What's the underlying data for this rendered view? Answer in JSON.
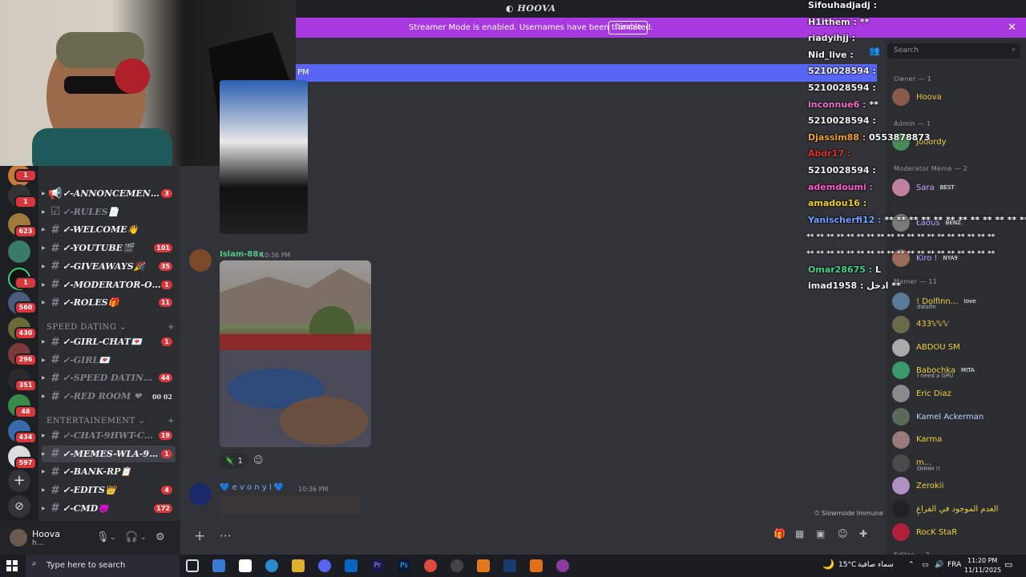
{
  "window": {
    "title": "HOOVA"
  },
  "notice": {
    "message": "Streamer Mode is enabled. Usernames have been truncated.",
    "action": "Disable"
  },
  "new_messages_bar": {
    "text": "PM"
  },
  "rail": {
    "badges": [
      "1",
      "1",
      "623",
      "1",
      "560",
      "430",
      "296",
      "351",
      "48",
      "434",
      "597"
    ]
  },
  "channels": [
    {
      "name": "✓-ANNONCEMENTS…",
      "badge": "3",
      "icon": "megaphone-icon"
    },
    {
      "name": "✓-RULES📄",
      "badge": "",
      "icon": "rules-icon",
      "dim": true
    },
    {
      "name": "✓-WELCOME👋",
      "badge": ""
    },
    {
      "name": "✓-YOUTUBE🎬",
      "badge": "101"
    },
    {
      "name": "✓-GIVEAWAYS🎉",
      "badge": "35"
    },
    {
      "name": "✓-MODERATOR-ON…",
      "badge": "1"
    },
    {
      "name": "✓-ROLES🎁",
      "badge": "11"
    }
  ],
  "category_speed": "SPEED DATING",
  "channels_speed": [
    {
      "name": "✓-GIRL-CHAT💌",
      "badge": "1"
    },
    {
      "name": "✓-GIRL💌",
      "badge": "",
      "dim": true
    },
    {
      "name": "✓-SPEED DATING💍",
      "badge": "44",
      "dim": true
    },
    {
      "name": "✓-RED ROOM ❤",
      "badge": "",
      "dim": true,
      "extra": "00  02"
    }
  ],
  "category_entertainment": "ENTERTAINEMENT",
  "channels_ent": [
    {
      "name": "✓-CHAT-9HWT-CH…",
      "badge": "19",
      "dim": true
    },
    {
      "name": "✓-MEMES-WLA-9W…",
      "badge": "1",
      "active": true
    },
    {
      "name": "✓-BANK-RP📋",
      "badge": ""
    },
    {
      "name": "✓-EDITS👑",
      "badge": "4"
    },
    {
      "name": "✓-CMD😈",
      "badge": "172"
    }
  ],
  "user": {
    "name": "Hoova",
    "status": "h…"
  },
  "messages": [
    {
      "author": "Islam-88x",
      "time": "10:36 PM",
      "color": "#57c98a"
    },
    {
      "author": "💙 e v o n y l 💙",
      "time": "10:36 PM",
      "color": "#6fb3ff"
    }
  ],
  "reaction": {
    "count": "1"
  },
  "slowmode": "Slowmode Immune",
  "search": {
    "placeholder": "Search"
  },
  "chat_overlay": [
    {
      "user": "Sifouhadjadj :",
      "msg": "",
      "color": "#f2f3f5"
    },
    {
      "user": "H1ithem :",
      "msg": "**",
      "color": "#f2f3f5"
    },
    {
      "user": "riadyihjj :",
      "msg": "",
      "color": "#f2f3f5"
    },
    {
      "user": "Nid_live :",
      "msg": "",
      "color": "#f2f3f5"
    },
    {
      "user": "5210028594 :",
      "msg": "",
      "color": "#f2f3f5"
    },
    {
      "user": "5210028594 :",
      "msg": "",
      "color": "#f2f3f5"
    },
    {
      "user": "inconnue6 :",
      "msg": "**",
      "color": "#f06fcf"
    },
    {
      "user": "5210028594 :",
      "msg": "",
      "color": "#f2f3f5"
    },
    {
      "user": "Djassim88 :",
      "msg": "0553878873",
      "color": "#f0a030"
    },
    {
      "user": "Abdr17 :",
      "msg": "",
      "color": "#e0302a"
    },
    {
      "user": "5210028594 :",
      "msg": "",
      "color": "#f2f3f5"
    },
    {
      "user": "ademdoumi :",
      "msg": "",
      "color": "#ff5ad0"
    },
    {
      "user": "amadou16 :",
      "msg": "",
      "color": "#f0d020"
    },
    {
      "user": "Yanischerfi12 :",
      "msg": "** ** ** ** ** ** ** ** ** ** ** ** ** ** **",
      "color": "#6fa0ff"
    },
    {
      "user": "",
      "msg": "** ** ** ** ** ** ** ** ** ** ** ** ** ** ** ** ** ** **",
      "color": "#fff"
    },
    {
      "user": "",
      "msg": "** ** ** ** ** ** ** ** ** ** ** ** ** ** ** ** ** ** **",
      "color": "#fff"
    },
    {
      "user": "Omar28675 :",
      "msg": "L",
      "color": "#4ad08a"
    },
    {
      "user": "imad1958 :",
      "msg": "ادخل **",
      "color": "#f2f3f5"
    }
  ],
  "members": {
    "owner_header": "Owner — 1",
    "owner": [
      {
        "name": "Hoova",
        "color": "#f0c040",
        "av": "#8a5a4a"
      }
    ],
    "admin_header": "Admin — 1",
    "admin": [
      {
        "name": "Jooordy",
        "color": "#f0d040",
        "av": "#4a8a5a"
      }
    ],
    "mod_header": "Moderator Meme — 2",
    "mods": [
      {
        "name": "Sara",
        "tag": "BEST",
        "color": "#d0a0ff",
        "av": "#c080a0"
      },
      {
        "name": "Łaσuѕ",
        "tag": "BENZ",
        "color": "#c0a0ff",
        "av": "#7a7a7a"
      },
      {
        "name": "Kiro !",
        "tag": "NYA9",
        "color": "#c0a0ff",
        "av": "#9a6a5a"
      }
    ],
    "member_header": "Memer — 11",
    "memers": [
      {
        "name": "! Dolfinn…",
        "sub": "dalafin",
        "tag": "love",
        "color": "#f0d040",
        "av": "#5a7a9a"
      },
      {
        "name": "433𝕍𝕍𝕍",
        "sub": "",
        "tag": "",
        "color": "#f0d040",
        "av": "#6a6a4a"
      },
      {
        "name": "ABDOU SM",
        "sub": "",
        "tag": "",
        "color": "#f0d040",
        "av": "#aaa"
      },
      {
        "name": "Babochka",
        "sub": "I need a GPU",
        "tag": "MITA",
        "color": "#f0d040",
        "av": "#3a9a6a"
      },
      {
        "name": "Eric Diaz",
        "sub": "",
        "tag": "",
        "color": "#f0d040",
        "av": "#8a8a8a"
      },
      {
        "name": "Kamel Ackerman",
        "sub": "",
        "tag": "",
        "color": "#c0d0ff",
        "av": "#5a6a5a"
      },
      {
        "name": "Karma",
        "sub": "",
        "tag": "",
        "color": "#f0d040",
        "av": "#9a7a7a"
      },
      {
        "name": "m...",
        "sub": "OHHH !!",
        "tag": "",
        "color": "#f0d040",
        "av": "#4a4a4a"
      },
      {
        "name": "Zerokii",
        "sub": "",
        "tag": "",
        "color": "#f0d040",
        "av": "#b090c0"
      },
      {
        "name": "العدم الموجود في الفراغ",
        "sub": "!",
        "tag": "",
        "color": "#f0d040",
        "av": "#222"
      },
      {
        "name": "RocK StaR",
        "sub": "",
        "tag": "",
        "color": "#f0d040",
        "av": "#b0203a"
      }
    ],
    "editor_header": "Editor — 2"
  },
  "taskbar": {
    "search_placeholder": "Type here to search",
    "weather": "15°C",
    "weather_text": "سماء صافية",
    "lang": "FRA",
    "time": "11:20 PM",
    "date": "11/11/2025"
  },
  "colors": {
    "accent": "#5865f2",
    "notice": "#a839e0",
    "danger": "#da373c"
  }
}
